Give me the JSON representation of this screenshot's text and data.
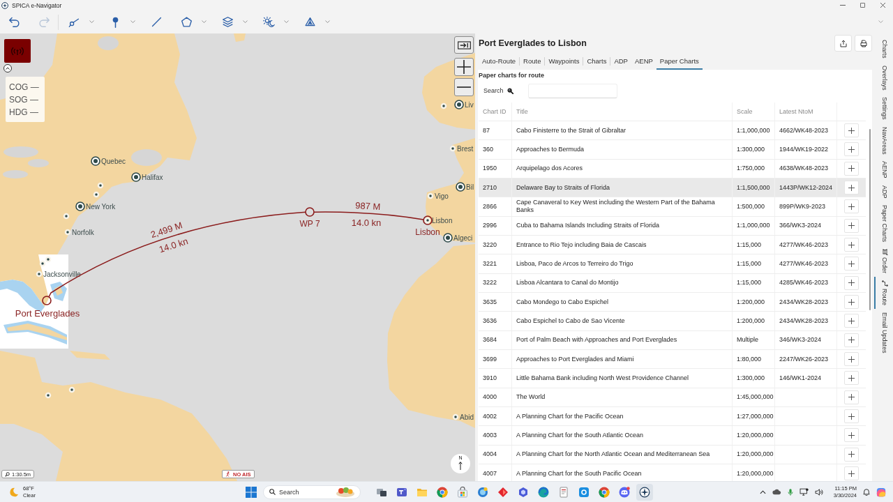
{
  "window": {
    "title": "SPICA e-Navigator"
  },
  "toolbar": [
    {
      "kind": "undo",
      "disabled": false,
      "dropdown": false
    },
    {
      "kind": "redo",
      "disabled": true,
      "dropdown": false
    },
    {
      "kind": "route",
      "disabled": false,
      "dropdown": true
    },
    {
      "kind": "pin",
      "disabled": false,
      "dropdown": true
    },
    {
      "kind": "line",
      "disabled": false,
      "dropdown": false
    },
    {
      "kind": "polygon",
      "disabled": false,
      "dropdown": true
    },
    {
      "kind": "layers",
      "disabled": false,
      "dropdown": true
    },
    {
      "kind": "day-night",
      "disabled": false,
      "dropdown": true
    },
    {
      "kind": "weather",
      "disabled": false,
      "dropdown": true
    }
  ],
  "map": {
    "readouts": [
      "COG —",
      "SOG —",
      "HDG —"
    ],
    "places": [
      {
        "name": "Liv",
        "kind": "port"
      },
      {
        "name": "Quebec",
        "kind": "port"
      },
      {
        "name": "Halifax",
        "kind": "port"
      },
      {
        "name": "New York",
        "kind": "port"
      },
      {
        "name": "Norfolk",
        "kind": "town"
      },
      {
        "name": "Jacksonville",
        "kind": "town"
      },
      {
        "name": "Brest",
        "kind": "town"
      },
      {
        "name": "Bil",
        "kind": "port"
      },
      {
        "name": "Vigo",
        "kind": "town"
      },
      {
        "name": "Lisbon",
        "kind": "town"
      },
      {
        "name": "Algeci",
        "kind": "port"
      },
      {
        "name": "Abid",
        "kind": "town"
      }
    ],
    "route": {
      "waypoints": [
        {
          "name": "Port Everglades"
        },
        {
          "name": "WP 7"
        },
        {
          "name": "Lisbon"
        }
      ],
      "legs": [
        {
          "distance": "2,499 M",
          "speed": "14.0 kn"
        },
        {
          "distance": "987 M",
          "speed": "14.0 kn"
        }
      ]
    },
    "scale": "1:30.5m",
    "ais_status": "NO AIS",
    "compass": "N"
  },
  "panel": {
    "title": "Port Everglades to Lisbon",
    "tabs": [
      {
        "label": "Auto-Route",
        "selected": false
      },
      {
        "label": "Route",
        "selected": false
      },
      {
        "label": "Waypoints",
        "selected": false
      },
      {
        "label": "Charts",
        "selected": false
      },
      {
        "label": "ADP",
        "selected": false
      },
      {
        "label": "AENP",
        "selected": false
      },
      {
        "label": "Paper Charts",
        "selected": true
      }
    ],
    "section": "Paper charts for route",
    "search": {
      "label": "Search"
    },
    "table": {
      "columns": [
        "Chart ID",
        "Title",
        "Scale",
        "Latest NtoM"
      ],
      "rows": [
        {
          "id": "87",
          "title": "Cabo Finisterre to the Strait of Gibraltar",
          "scale": "1:1,000,000",
          "ntom": "4662/WK48-2023",
          "highlighted": false
        },
        {
          "id": "360",
          "title": "Approaches to Bermuda",
          "scale": "1:300,000",
          "ntom": "1944/WK19-2022",
          "highlighted": false
        },
        {
          "id": "1950",
          "title": "Arquipelago dos Acores",
          "scale": "1:750,000",
          "ntom": "4638/WK48-2023",
          "highlighted": false
        },
        {
          "id": "2710",
          "title": "Delaware Bay to Straits of Florida",
          "scale": "1:1,500,000",
          "ntom": "1443P/WK12-2024",
          "highlighted": true
        },
        {
          "id": "2866",
          "title": "Cape Canaveral to Key West including the Western Part of the Bahama Banks",
          "scale": "1:500,000",
          "ntom": "899P/WK9-2023",
          "highlighted": false
        },
        {
          "id": "2996",
          "title": "Cuba to Bahama Islands Including Straits of Florida",
          "scale": "1:1,000,000",
          "ntom": "366/WK3-2024",
          "highlighted": false
        },
        {
          "id": "3220",
          "title": "Entrance to Rio Tejo including Baia de Cascais",
          "scale": "1:15,000",
          "ntom": "4277/WK46-2023",
          "highlighted": false
        },
        {
          "id": "3221",
          "title": "Lisboa, Paco de Arcos to Terreiro do Trigo",
          "scale": "1:15,000",
          "ntom": "4277/WK46-2023",
          "highlighted": false
        },
        {
          "id": "3222",
          "title": "Lisboa Alcantara to Canal do Montijo",
          "scale": "1:15,000",
          "ntom": "4285/WK46-2023",
          "highlighted": false
        },
        {
          "id": "3635",
          "title": "Cabo Mondego to Cabo Espichel",
          "scale": "1:200,000",
          "ntom": "2434/WK28-2023",
          "highlighted": false
        },
        {
          "id": "3636",
          "title": "Cabo Espichel to Cabo de Sao Vicente",
          "scale": "1:200,000",
          "ntom": "2434/WK28-2023",
          "highlighted": false
        },
        {
          "id": "3684",
          "title": "Port of Palm Beach with Approaches and Port Everglades",
          "scale": "Multiple",
          "ntom": "346/WK3-2024",
          "highlighted": false
        },
        {
          "id": "3699",
          "title": "Approaches to Port Everglades and Miami",
          "scale": "1:80,000",
          "ntom": "2247/WK26-2023",
          "highlighted": false
        },
        {
          "id": "3910",
          "title": "Little Bahama Bank including North West Providence Channel",
          "scale": "1:300,000",
          "ntom": "146/WK1-2024",
          "highlighted": false
        },
        {
          "id": "4000",
          "title": "The World",
          "scale": "1:45,000,000",
          "highlighted": false
        },
        {
          "id": "4002",
          "title": "A Planning Chart for the Pacific Ocean",
          "scale": "1:27,000,000",
          "highlighted": false
        },
        {
          "id": "4003",
          "title": "A Planning Chart for the South Atlantic Ocean",
          "scale": "1:20,000,000",
          "highlighted": false
        },
        {
          "id": "4004",
          "title": "A Planning Chart for the North Atlantic Ocean and Mediterranean Sea",
          "scale": "1:20,000,000",
          "highlighted": false
        },
        {
          "id": "4007",
          "title": "A Planning Chart for the South Pacific Ocean",
          "scale": "1:20,000,000",
          "highlighted": false
        }
      ]
    }
  },
  "side_tabs": [
    {
      "label": "Charts",
      "kind": "plain",
      "selected": false
    },
    {
      "label": "Overlays",
      "kind": "plain",
      "selected": false
    },
    {
      "label": "Settings",
      "kind": "plain",
      "selected": false
    },
    {
      "label": "NavAreas",
      "kind": "plain",
      "selected": false
    },
    {
      "label": "AENP",
      "kind": "plain",
      "selected": false
    },
    {
      "label": "ADP",
      "kind": "plain",
      "selected": false
    },
    {
      "label": "Paper Charts",
      "kind": "plain",
      "selected": false
    },
    {
      "label": "Order",
      "kind": "order",
      "selected": false
    },
    {
      "label": "Route",
      "kind": "route",
      "selected": true
    },
    {
      "label": "Email Updates",
      "kind": "plain",
      "selected": false
    }
  ],
  "taskbar": {
    "weather": {
      "temperature": "68°F",
      "condition": "Clear"
    },
    "search": {
      "placeholder": "Search"
    },
    "apps": [
      {
        "kind": "task-view",
        "active": false
      },
      {
        "kind": "chat",
        "active": false
      },
      {
        "kind": "files",
        "active": false
      },
      {
        "kind": "browser",
        "active": false
      },
      {
        "kind": "store",
        "active": false
      },
      {
        "kind": "sphere",
        "active": false
      },
      {
        "kind": "diamond",
        "active": false
      },
      {
        "kind": "hexagon",
        "active": false
      },
      {
        "kind": "swirl",
        "active": false
      },
      {
        "kind": "notes",
        "active": false
      },
      {
        "kind": "tile",
        "active": false
      },
      {
        "kind": "browser",
        "active": false
      },
      {
        "kind": "gamepad",
        "active": false
      },
      {
        "kind": "compass",
        "active": true
      }
    ],
    "time": "11:15 PM",
    "date": "3/30/2024"
  }
}
